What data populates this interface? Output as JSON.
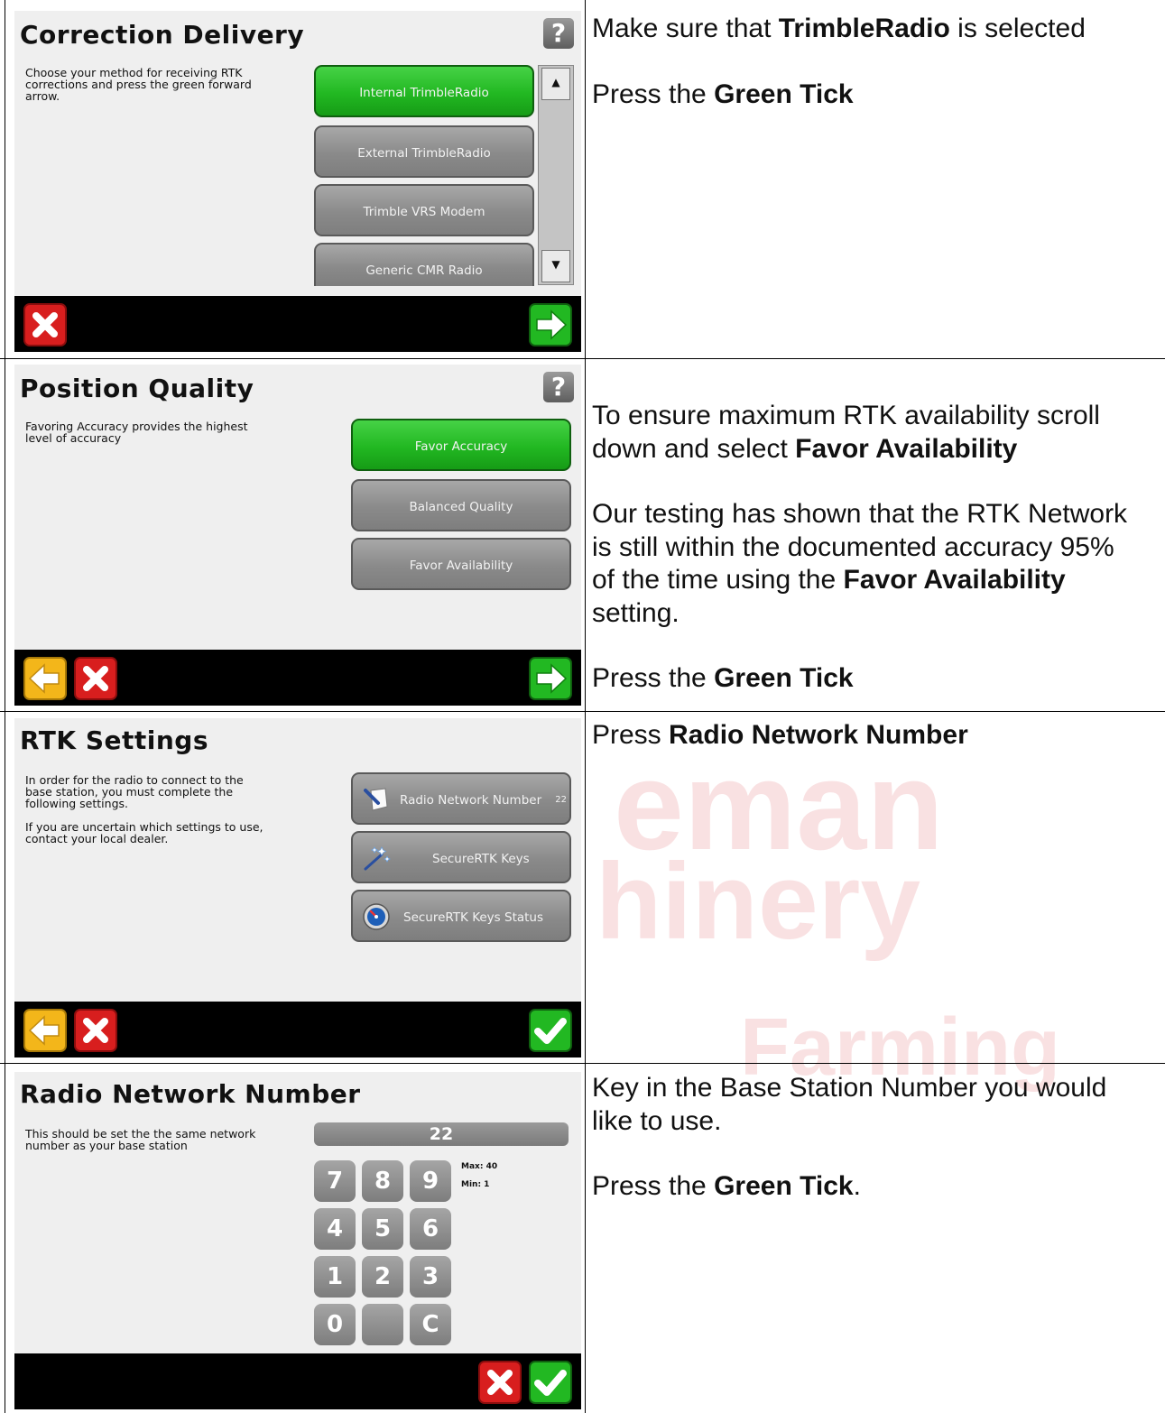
{
  "watermark": {
    "line1": "eman",
    "line2": "hinery",
    "line3": "Farming"
  },
  "colors": {
    "green": "#22b822",
    "grey_button": "#8a8a8a",
    "cancel_red": "#d81e1e",
    "back_yellow": "#f3b61a",
    "watermark_red": "#d21f2a"
  },
  "rows": [
    {
      "screen": {
        "title": "Correction Delivery",
        "help_label": "?",
        "description": "Choose your method for receiving RTK\ncorrections and press the green forward\narrow.",
        "options": [
          "Internal TrimbleRadio",
          "External TrimbleRadio",
          "Trimble VRS Modem",
          "Generic CMR Radio"
        ],
        "selected_option": "Internal TrimbleRadio",
        "scroll_up_icon": "up-arrow-icon",
        "scroll_down_icon": "down-arrow-icon",
        "footer_buttons": [
          "cancel-icon",
          "forward-arrow-icon"
        ]
      },
      "instructions": [
        {
          "pre": "Make sure that ",
          "bold": "TrimbleRadio",
          "post": " is selected"
        },
        {
          "pre": "Press the ",
          "bold": "Green Tick",
          "post": ""
        }
      ]
    },
    {
      "screen": {
        "title": "Position Quality",
        "help_label": "?",
        "description": "Favoring Accuracy provides the highest\nlevel of accuracy",
        "options": [
          "Favor Accuracy",
          "Balanced Quality",
          "Favor Availability"
        ],
        "selected_option": "Favor Accuracy",
        "footer_buttons": [
          "back-arrow-icon",
          "cancel-icon",
          "forward-arrow-icon"
        ]
      },
      "instructions": {
        "p1_pre": "To ensure maximum RTK availability scroll down and select ",
        "p1_bold": "Favor Availability",
        "p2_pre": "Our testing has shown that the RTK Network is still within the documented accuracy 95% of the time using the ",
        "p2_bold": "Favor Availability",
        "p2_post": " setting.",
        "p3_pre": "Press the ",
        "p3_bold": "Green Tick"
      }
    },
    {
      "screen": {
        "title": "RTK Settings",
        "description": "In order for the radio to connect to the\nbase station, you must complete the\nfollowing settings.\n\nIf you are uncertain which settings to use,\n contact your local dealer.",
        "options": [
          {
            "label": "Radio Network Number",
            "value": "22",
            "icon": "notepad-pen-icon"
          },
          {
            "label": "SecureRTK Keys",
            "icon": "magic-wand-icon"
          },
          {
            "label": "SecureRTK Keys Status",
            "icon": "gauge-icon"
          }
        ],
        "footer_buttons": [
          "back-arrow-icon",
          "cancel-icon",
          "confirm-tick-icon"
        ]
      },
      "instructions": {
        "pre": "Press ",
        "bold": "Radio Network Number"
      }
    },
    {
      "screen": {
        "title": "Radio Network Number",
        "description": "This should be set the the same network\nnumber as your base station",
        "value": "22",
        "max_label": "Max: 40",
        "min_label": "Min: 1",
        "keys": [
          "7",
          "8",
          "9",
          "4",
          "5",
          "6",
          "1",
          "2",
          "3",
          "0",
          "",
          "C"
        ],
        "footer_buttons": [
          "cancel-icon",
          "confirm-tick-icon"
        ]
      },
      "instructions": {
        "p1": "Key in the Base Station Number you would like to use.",
        "p2_pre": "Press the ",
        "p2_bold": "Green Tick",
        "p2_post": "."
      }
    }
  ]
}
